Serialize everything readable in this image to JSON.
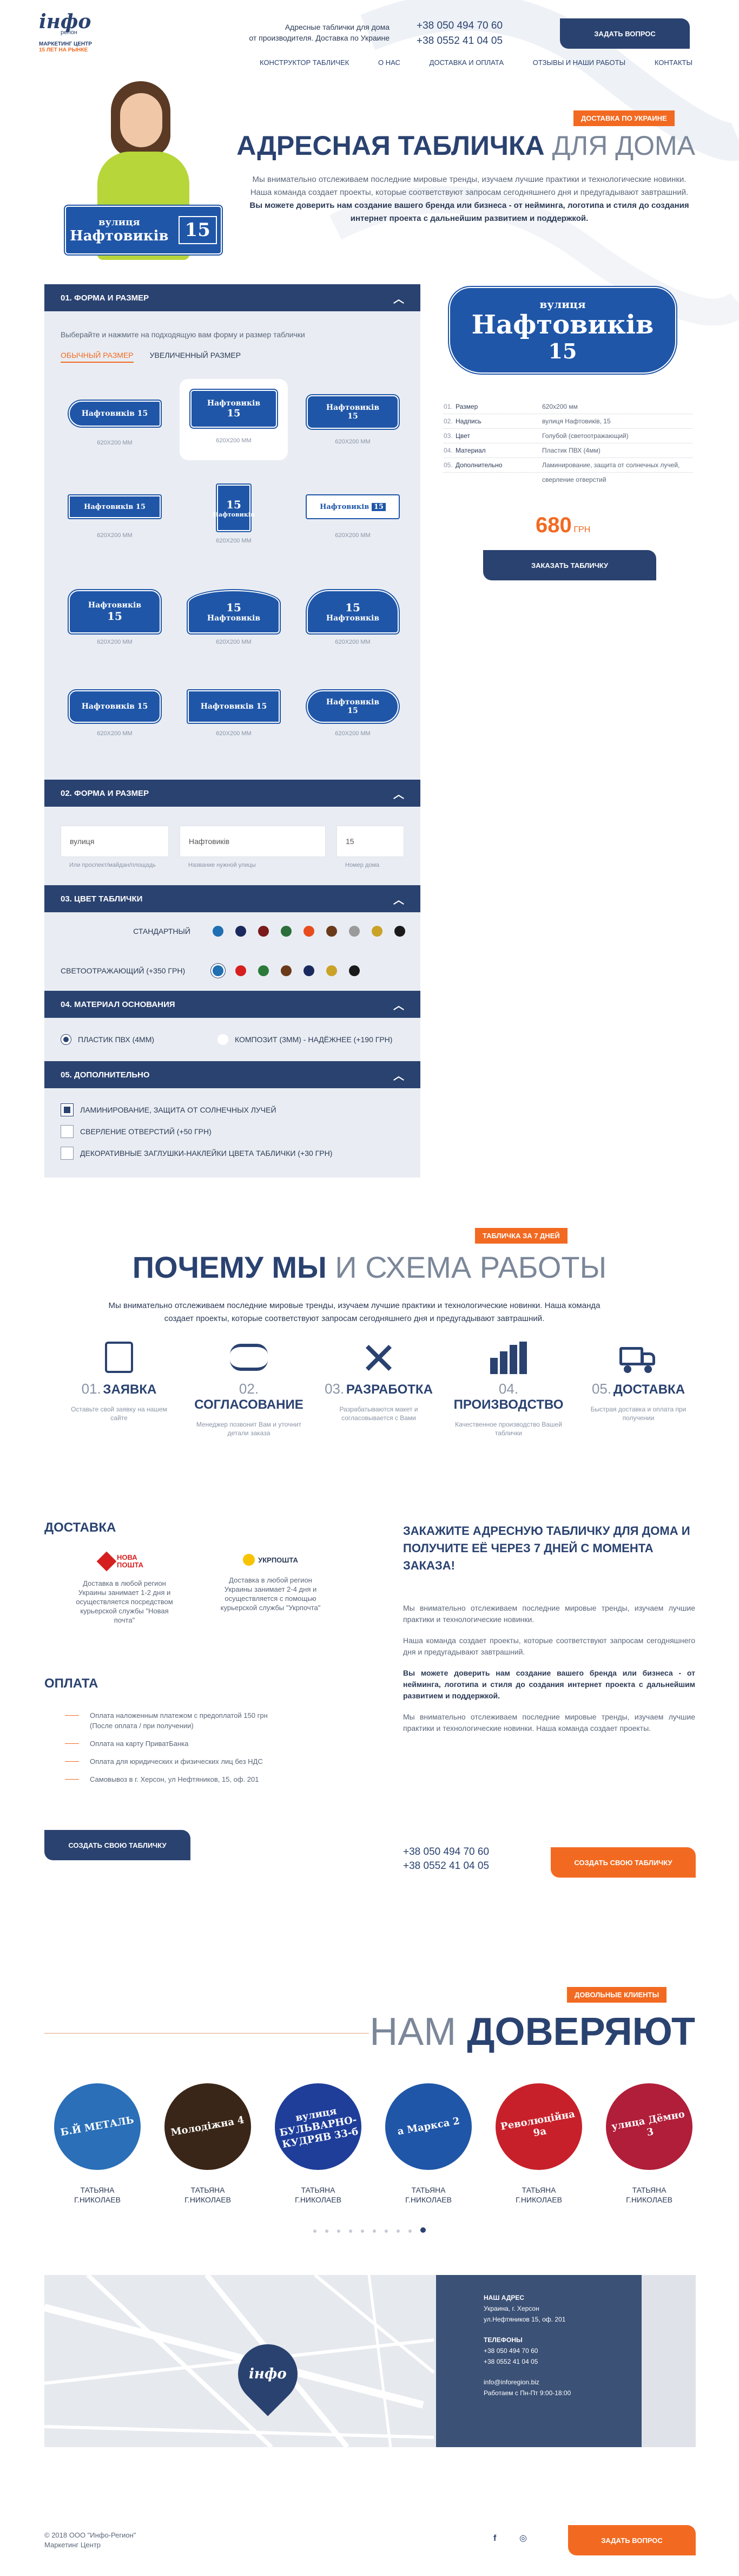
{
  "header": {
    "logo_main": "інфо",
    "logo_sub": "регіон",
    "logo_tag1": "МАРКЕТИНГ ЦЕНТР",
    "logo_tag2": "15 лет на рынке",
    "tagline1": "Адресные таблички для дома",
    "tagline2": "от производителя. Доставка по Украине",
    "phone1": "+38 050 494 70 60",
    "phone2": "+38 0552 41 04 05",
    "cta": "Задать вопрос",
    "nav": [
      "Конструктор табличек",
      "О нас",
      "Доставка и оплата",
      "Отзывы и наши работы",
      "Контакты"
    ]
  },
  "hero": {
    "badge": "Доставка по Украине",
    "title_bold": "Адресная табличка",
    "title_light": "для дома",
    "text": "Мы внимательно отслеживаем последние мировые тренды, изучаем лучшие практики и технологические новинки. Наша команда создает проекты, которые соответствуют запросам сегодняшнего дня и предугадывают завтрашний.",
    "text_bold": "Вы можете доверить нам создание вашего бренда или бизнеса - от нейминга, логотипа и стиля до создания интернет проекта с дальнейшим развитием и поддержкой.",
    "sign_street": "вулиця",
    "sign_name": "Нафтовиків",
    "sign_num": "15"
  },
  "configurator": {
    "sec1_title": "01. Форма и размер",
    "sec1_hint": "Выберайте и нажмите на подходящую вам форму и размер таблички",
    "tab_regular": "Обычный размер",
    "tab_large": "Увеличенный размер",
    "size_label": "620Х200 ММ",
    "plate_street": "вулиця",
    "plate_name": "Нафтовиків",
    "plate_num": "15",
    "sec2_title": "02. Форма и размер",
    "field1_value": "вулиця",
    "field1_hint": "Или проспект/майдан/площадь",
    "field2_value": "Нафтовиків",
    "field2_hint": "Название нужной улицы",
    "field3_value": "15",
    "field3_hint": "Номер дома",
    "sec3_title": "03. Цвет таблички",
    "color_standard": "Стандартный",
    "color_reflective": "Светоотражающий (+350 грн)",
    "colors_standard": [
      "#1f6fb2",
      "#1a2a5e",
      "#7a1a1a",
      "#2c6e3a",
      "#e84c1e",
      "#6a3a1a",
      "#9a9a9a",
      "#c9a227",
      "#1a1a1a"
    ],
    "colors_reflective": [
      "#1f6fb2",
      "#d62020",
      "#2c7a3a",
      "#6a3a1a",
      "#1a2a5e",
      "#c9a227",
      "#1a1a1a"
    ],
    "sec4_title": "04. Материал основания",
    "material1": "Пластик ПВХ (4мм)",
    "material2": "Композит (3мм) - надёжнее (+190 грн)",
    "sec5_title": "05. Дополнительно",
    "extra1": "Ламинирование, защита от солнечных лучей",
    "extra2": "Сверление отверстий (+50 грн)",
    "extra3": "Декоративные заглушки-наклейки цвета таблички (+30 грн)"
  },
  "summary": {
    "rows": [
      {
        "n": "01.",
        "k": "Размер",
        "v": "620х200 мм"
      },
      {
        "n": "02.",
        "k": "Надпись",
        "v": "вулиця Нафтовиків, 15"
      },
      {
        "n": "03.",
        "k": "Цвет",
        "v": "Голубой (светоотражающий)"
      },
      {
        "n": "04.",
        "k": "Материал",
        "v": "Пластик ПВХ (4мм)"
      },
      {
        "n": "05.",
        "k": "Дополнительно",
        "v": "Ламинирование, защита от солнечных лучей,"
      },
      {
        "n": "",
        "k": "",
        "v": "сверление отверстий"
      }
    ],
    "price": "680",
    "currency": "ГРН",
    "order": "Заказать табличку"
  },
  "why": {
    "badge": "Табличка за 7 дней",
    "title_bold": "Почему мы",
    "title_light": "и схема работы",
    "text": "Мы внимательно отслеживаем последние мировые тренды, изучаем лучшие практики и технологические новинки. Наша команда создает проекты, которые соответствуют запросам сегодняшнего дня и предугадывают завтрашний.",
    "steps": [
      {
        "num": "01.",
        "name": "Заявка",
        "desc": "Оставьте свой заявку на нашем сайте"
      },
      {
        "num": "02.",
        "name": "Согласование",
        "desc": "Менеджер позвонит Вам и уточнит детали заказа"
      },
      {
        "num": "03.",
        "name": "Разработка",
        "desc": "Разрабатываются макет и согласовывается с Вами"
      },
      {
        "num": "04.",
        "name": "Производство",
        "desc": "Качественное производство Вашей таблички"
      },
      {
        "num": "05.",
        "name": "Доставка",
        "desc": "Быстрая доставка и оплата при получении"
      }
    ]
  },
  "delivery": {
    "title": "Доставка",
    "np_name": "НОВА ПОШТА",
    "np_text": "Доставка в любой регион Украины занимает 1-2 дня и осуществляется посредством курьерской службы \"Новая почта\"",
    "up_name": "УКРПОШТА",
    "up_text": "Доставка в любой регион Украины занимает 2-4 дня и осуществляется с помощью курьерской службы \"Укрпочта\"",
    "pay_title": "Оплата",
    "pay": [
      "Оплата наложенным платежом с предоплатой 150 грн",
      "(После оплата / при получении)",
      "Оплата на карту ПриватБанка",
      "Оплата для юридических и физических лиц без НДС",
      "Самовывоз в г. Херсон, ул Нефтяников, 15, оф. 201"
    ],
    "cta": "Создать свою табличку"
  },
  "order_block": {
    "title": "Закажите адресную табличку для дома и получите её через 7 дней с момента заказа!",
    "p1": "Мы внимательно отслеживаем последние мировые тренды, изучаем лучшие практики и технологические новинки.",
    "p2": "Наша команда создает проекты, которые соответствуют запросам сегодняшнего дня и предугадывают завтрашний.",
    "p3": "Вы можете доверить нам создание вашего бренда или бизнеса - от нейминга, логотипа и стиля до создания интернет проекта с дальнейшим развитием и поддержкой.",
    "p4": "Мы внимательно отслеживаем последние мировые тренды, изучаем лучшие практики и технологические новинки. Наша команда создает проекты.",
    "phone1": "+38 050 494 70 60",
    "phone2": "+38 0552 41 04 05",
    "cta": "Создать свою табличку"
  },
  "trust": {
    "badge": "Довольные клиенты",
    "title_light": "Нам",
    "title_bold": "доверяют",
    "clients": [
      {
        "name": "Татьяна",
        "city": "г.Николаев",
        "sign": "Б.Й МЕТАЛЬ"
      },
      {
        "name": "Татьяна",
        "city": "г.Николаев",
        "sign": "Молодіжна 4"
      },
      {
        "name": "Татьяна",
        "city": "г.Николаев",
        "sign": "вулиця БУЛЬВАРНО-КУДРЯВ 33-б"
      },
      {
        "name": "Татьяна",
        "city": "г.Николаев",
        "sign": "а Маркса 2"
      },
      {
        "name": "Татьяна",
        "city": "г.Николаев",
        "sign": "Революційна 9а"
      },
      {
        "name": "Татьяна",
        "city": "г.Николаев",
        "sign": "улица Дёмно 3"
      }
    ]
  },
  "contacts": {
    "addr_title": "Наш адрес",
    "addr1": "Украина, г. Херсон",
    "addr2": "ул.Нефтяников 15, оф. 201",
    "tel_title": "Телефоны",
    "tel1": "+38 050 494 70 60",
    "tel2": "+38 0552 41 04 05",
    "email": "info@inforegion.biz",
    "hours": "Работаем с Пн-Пт 9:00-18:00"
  },
  "footer": {
    "copy1": "© 2018 ООО \"Инфо-Регион\"",
    "copy2": "Маркетинг Центр",
    "fb": "f",
    "ig": "◎",
    "cta": "Задать вопрос"
  }
}
